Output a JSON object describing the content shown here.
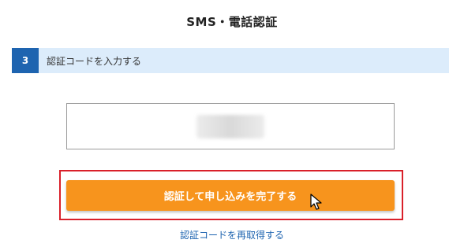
{
  "page": {
    "title": "SMS・電話認証"
  },
  "step": {
    "number": "3",
    "label": "認証コードを入力する"
  },
  "code_input": {
    "value": "",
    "value_obscured": true
  },
  "actions": {
    "submit_label": "認証して申し込みを完了する",
    "resend_label": "認証コードを再取得する"
  },
  "colors": {
    "accent_orange": "#f7941d",
    "step_blue": "#1e64b0",
    "step_bar_bg": "#dcecfb",
    "highlight_red": "#d9202a",
    "link_blue": "#1e64b0"
  },
  "icons": {
    "cursor": "mouse-pointer-icon"
  }
}
